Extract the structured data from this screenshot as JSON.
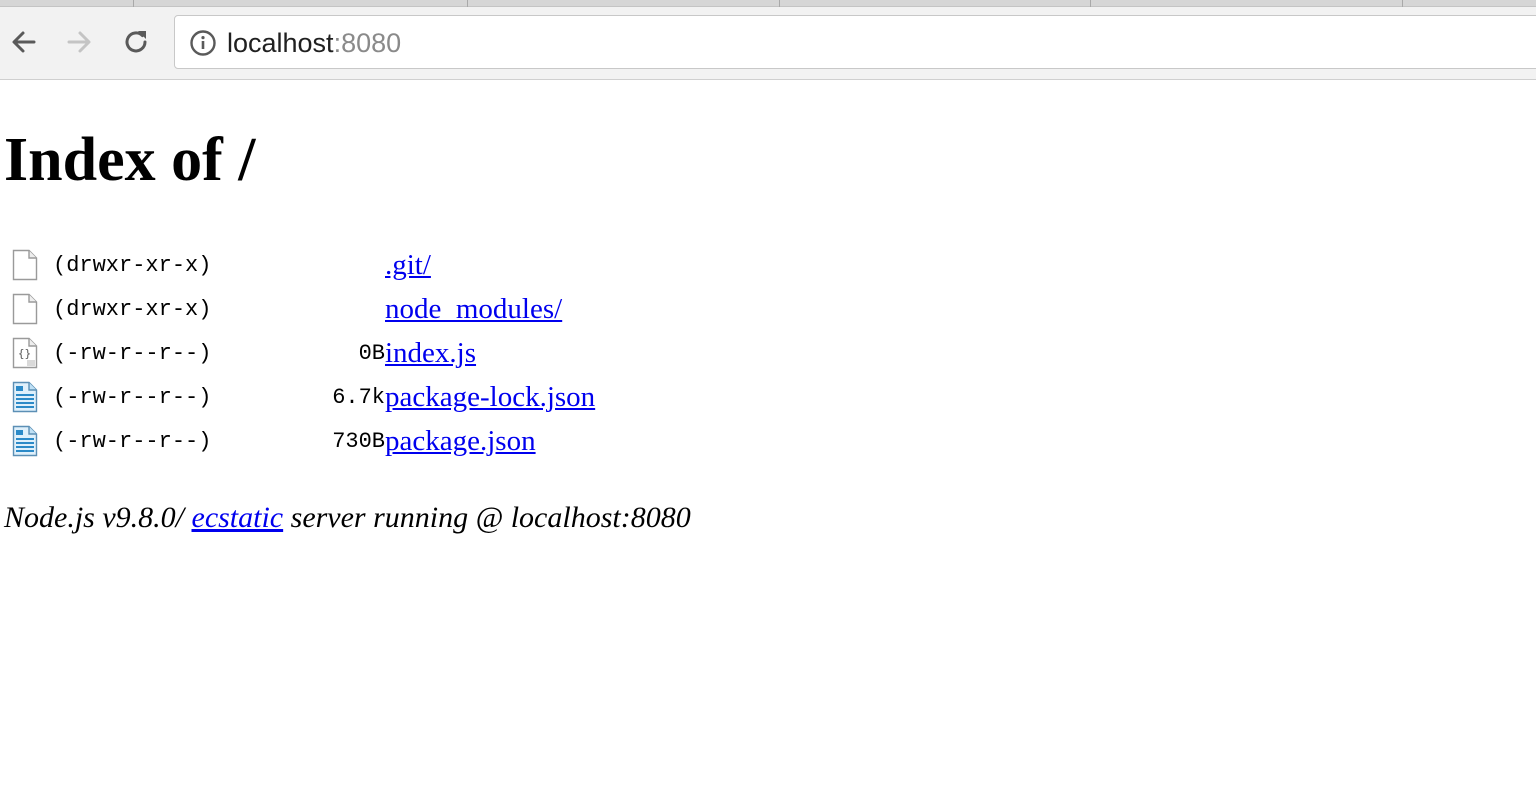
{
  "browser": {
    "url_host": "localhost",
    "url_port": ":8080",
    "back_icon": "arrow-left-icon",
    "forward_icon": "arrow-right-icon",
    "reload_icon": "reload-icon",
    "info_icon": "info-circle-icon"
  },
  "page": {
    "title": "Index of /",
    "entries": [
      {
        "icon": "blank-file-icon",
        "perm": "(drwxr-xr-x)",
        "size": "",
        "name": ".git/"
      },
      {
        "icon": "blank-file-icon",
        "perm": "(drwxr-xr-x)",
        "size": "",
        "name": "node_modules/"
      },
      {
        "icon": "script-file-icon",
        "perm": "(-rw-r--r--)",
        "size": "0B",
        "name": "index.js"
      },
      {
        "icon": "text-file-icon",
        "perm": "(-rw-r--r--)",
        "size": "6.7k",
        "name": "package-lock.json"
      },
      {
        "icon": "text-file-icon",
        "perm": "(-rw-r--r--)",
        "size": "730B",
        "name": "package.json"
      }
    ],
    "footer": {
      "prefix": "Node.js v9.8.0/",
      "link": "ecstatic",
      "suffix": " server running @ localhost:8080"
    }
  },
  "colors": {
    "link": "#0000ee",
    "toolbar": "#f2f2f2",
    "port_gray": "#8a8a8a"
  }
}
